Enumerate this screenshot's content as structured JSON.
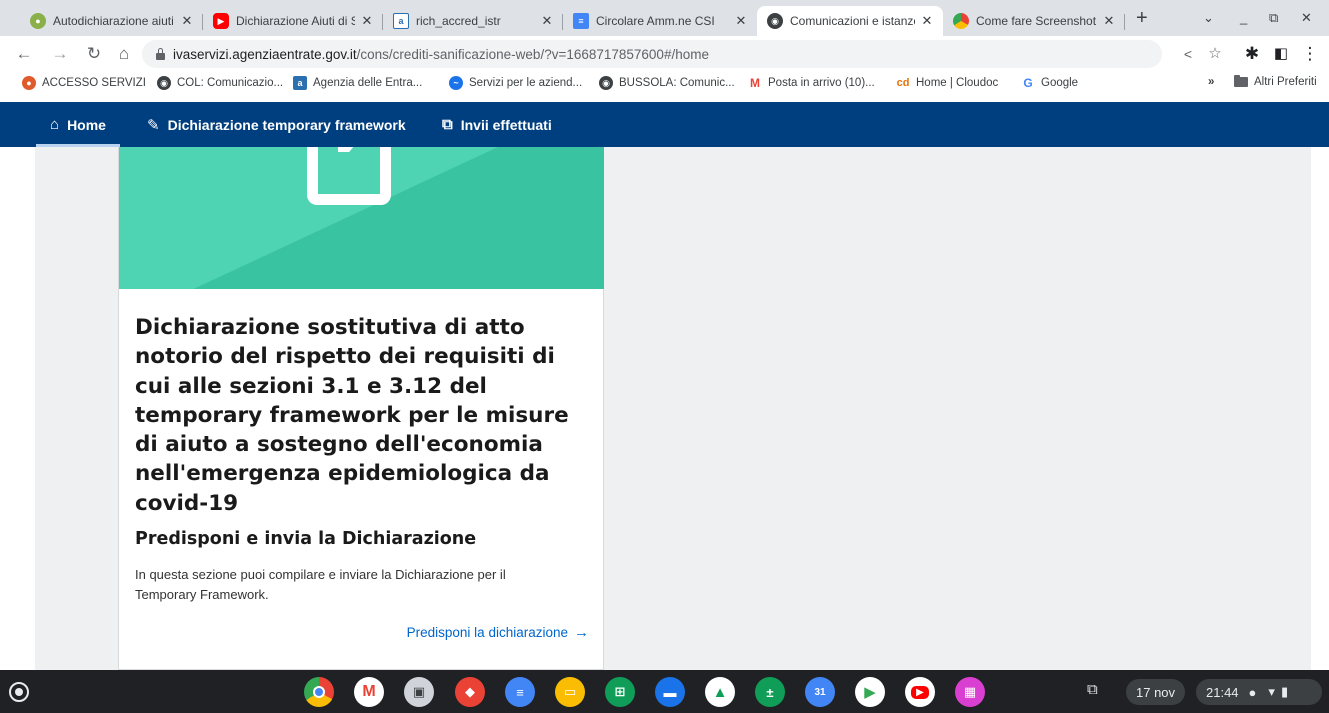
{
  "browser": {
    "tabs": [
      {
        "title": "Autodichiarazione aiuti",
        "favicon": "agenzia-entrate-icon",
        "color": "#8ab04a",
        "active": false
      },
      {
        "title": "Dichiarazione Aiuti di St",
        "favicon": "youtube-icon",
        "color": "#ff0000",
        "active": false
      },
      {
        "title": "rich_accred_istr",
        "favicon": "pdf-icon",
        "color": "#ffffff",
        "active": false
      },
      {
        "title": "Circolare Amm.ne CSI",
        "favicon": "docs-icon",
        "color": "#4285f4",
        "active": false
      },
      {
        "title": "Comunicazioni e istanze",
        "favicon": "globe-icon",
        "color": "#3c4043",
        "active": true
      },
      {
        "title": "Come fare Screenshot",
        "favicon": "chrome-icon",
        "color": "#4285f4",
        "active": false
      }
    ],
    "url_host": "ivaservizi.agenziaentrate.gov.it",
    "url_path": "/cons/crediti-sanificazione-web/?v=1668717857600#/home",
    "bookmarks": [
      {
        "label": "ACCESSO SERVIZI",
        "icon": "accesso-icon",
        "color": "#e05a2b"
      },
      {
        "label": "COL: Comunicazio...",
        "icon": "globe-icon",
        "color": "#3c4043"
      },
      {
        "label": "Agenzia delle Entra...",
        "icon": "agenzia-icon",
        "color": "#2a6fb0"
      },
      {
        "label": "Servizi per le aziend...",
        "icon": "servizi-icon",
        "color": "#1a73e8"
      },
      {
        "label": "BUSSOLA: Comunic...",
        "icon": "globe-icon",
        "color": "#3c4043"
      },
      {
        "label": "Posta in arrivo (10)...",
        "icon": "gmail-icon",
        "color": "#ea4335"
      },
      {
        "label": "Home | Cloudoc",
        "icon": "cloudoc-icon",
        "color": "#e8710a"
      },
      {
        "label": "Google",
        "icon": "google-icon",
        "color": "#4285f4"
      }
    ],
    "more_bookmarks": "»",
    "other_bookmarks": "Altri Preferiti"
  },
  "nav": {
    "home": "Home",
    "declaration": "Dichiarazione temporary framework",
    "sent": "Invii effettuati"
  },
  "card": {
    "title": "Dichiarazione sostitutiva di atto notorio del rispetto dei requisiti di cui alle sezioni 3.1 e 3.12 del temporary framework per le misure di aiuto a sostegno dell'economia nell'emergenza epidemiologica da covid-19",
    "subtitle": "Predisponi e invia la Dichiarazione",
    "description": "In questa sezione puoi compilare e inviare la Dichiarazione per il Temporary Framework.",
    "link": "Predisponi la dichiarazione",
    "accent_color": "#3ac3a0"
  },
  "shelf": {
    "apps": [
      {
        "name": "chrome-icon",
        "color": "#ea4335"
      },
      {
        "name": "gmail-icon",
        "color": "#ffffff"
      },
      {
        "name": "camera-icon",
        "color": "#d0d4da"
      },
      {
        "name": "remote-desktop-icon",
        "color": "#ea4335"
      },
      {
        "name": "docs-icon",
        "color": "#4285f4"
      },
      {
        "name": "slides-icon",
        "color": "#fbbc04"
      },
      {
        "name": "sheets-icon",
        "color": "#0f9d58"
      },
      {
        "name": "files-icon",
        "color": "#1a73e8"
      },
      {
        "name": "drive-icon",
        "color": "#fbbc04"
      },
      {
        "name": "calculator-icon",
        "color": "#0f9d58"
      },
      {
        "name": "calendar-icon",
        "color": "#4285f4"
      },
      {
        "name": "play-store-icon",
        "color": "#34a853"
      },
      {
        "name": "youtube-icon",
        "color": "#ff0000"
      },
      {
        "name": "gallery-icon",
        "color": "#d93fd1"
      }
    ],
    "date": "17 nov",
    "time": "21:44"
  }
}
